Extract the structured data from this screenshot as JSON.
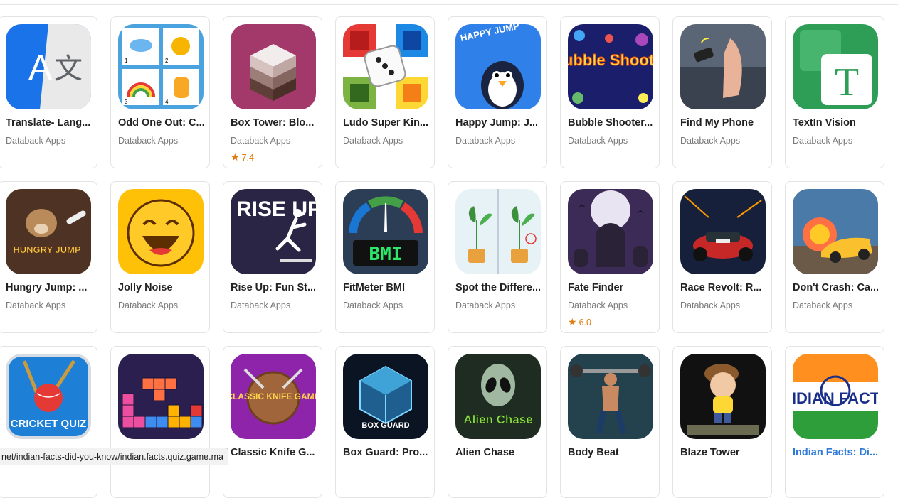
{
  "apps": [
    {
      "title": "Translate- Lang...",
      "developer": "Databack Apps",
      "rating": "",
      "icon": "translate-icon"
    },
    {
      "title": "Odd One Out: C...",
      "developer": "Databack Apps",
      "rating": "",
      "icon": "odd-one-out-icon"
    },
    {
      "title": "Box Tower: Blo...",
      "developer": "Databack Apps",
      "rating": "7.4",
      "icon": "box-tower-icon"
    },
    {
      "title": "Ludo Super Kin...",
      "developer": "Databack Apps",
      "rating": "",
      "icon": "ludo-icon"
    },
    {
      "title": "Happy Jump: J...",
      "developer": "Databack Apps",
      "rating": "",
      "icon": "happy-jump-icon",
      "icon_text": "HAPPY JUMP"
    },
    {
      "title": "Bubble Shooter...",
      "developer": "Databack Apps",
      "rating": "",
      "icon": "bubble-shooter-icon",
      "icon_text": "Bubble Shooter"
    },
    {
      "title": "Find My Phone",
      "developer": "Databack Apps",
      "rating": "",
      "icon": "find-my-phone-icon"
    },
    {
      "title": "TextIn Vision",
      "developer": "Databack Apps",
      "rating": "",
      "icon": "textin-vision-icon",
      "icon_text": "T"
    },
    {
      "title": "Hungry Jump: ...",
      "developer": "Databack Apps",
      "rating": "",
      "icon": "hungry-jump-icon",
      "icon_text": "HUNGRY JUMP"
    },
    {
      "title": "Jolly Noise",
      "developer": "Databack Apps",
      "rating": "",
      "icon": "jolly-noise-icon"
    },
    {
      "title": "Rise Up: Fun St...",
      "developer": "Databack Apps",
      "rating": "",
      "icon": "rise-up-icon",
      "icon_text": "RISE UP"
    },
    {
      "title": "FitMeter BMI",
      "developer": "Databack Apps",
      "rating": "",
      "icon": "bmi-icon",
      "icon_text": "BMI"
    },
    {
      "title": "Spot the Differe...",
      "developer": "Databack Apps",
      "rating": "",
      "icon": "spot-difference-icon"
    },
    {
      "title": "Fate Finder",
      "developer": "Databack Apps",
      "rating": "6.0",
      "icon": "fate-finder-icon"
    },
    {
      "title": "Race Revolt: R...",
      "developer": "Databack Apps",
      "rating": "",
      "icon": "race-revolt-icon"
    },
    {
      "title": "Don't Crash: Ca...",
      "developer": "Databack Apps",
      "rating": "",
      "icon": "dont-crash-icon"
    },
    {
      "title": "",
      "developer": "",
      "rating": "",
      "icon": "cricket-quiz-icon",
      "icon_text": "CRICKET QUIZ"
    },
    {
      "title": "",
      "developer": "",
      "rating": "",
      "icon": "block-puzzle-icon"
    },
    {
      "title": "Classic Knife G...",
      "developer": "",
      "rating": "",
      "icon": "knife-game-icon",
      "icon_text": "CLASSIC KNIFE GAME"
    },
    {
      "title": "Box Guard: Pro...",
      "developer": "",
      "rating": "",
      "icon": "box-guard-icon",
      "icon_text": "BOX GUARD"
    },
    {
      "title": "Alien Chase",
      "developer": "",
      "rating": "",
      "icon": "alien-chase-icon",
      "icon_text": "Alien Chase"
    },
    {
      "title": "Body Beat",
      "developer": "",
      "rating": "",
      "icon": "body-beat-icon"
    },
    {
      "title": "Blaze Tower",
      "developer": "",
      "rating": "",
      "icon": "blaze-tower-icon"
    },
    {
      "title": "Indian Facts: Di...",
      "developer": "",
      "rating": "",
      "icon": "indian-facts-icon",
      "icon_text": "INDIAN FACTS",
      "hovered": true
    }
  ],
  "status_bar": {
    "url": "net/indian-facts-did-you-know/indian.facts.quiz.game.ma"
  },
  "colors": {
    "rating": "#e07d10",
    "link": "#2f7ad9",
    "card_border": "#e3e3e3"
  }
}
